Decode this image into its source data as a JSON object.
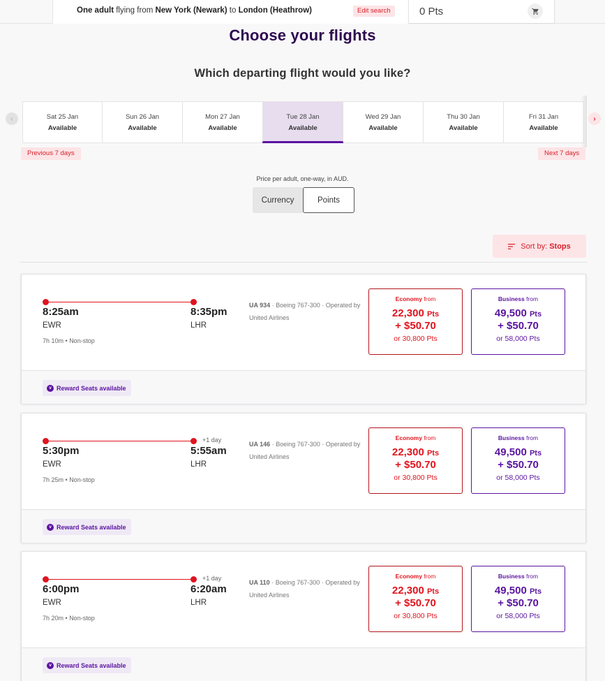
{
  "header": {
    "summary_prefix_bold": "One adult",
    "summary_mid1": " flying from ",
    "origin": "New York (Newark)",
    "summary_mid2": " to ",
    "destination": "London (Heathrow)",
    "edit_search_label": "Edit search",
    "points_balance": "0 Pts",
    "cart_icon": "shopping-cart-icon"
  },
  "page": {
    "title": "Choose your flights",
    "subtitle": "Which departing flight would you like?"
  },
  "date_strip": {
    "prev_arrow": "‹",
    "next_arrow": "›",
    "dates": [
      {
        "date": "Sat 25 Jan",
        "status": "Available",
        "selected": false
      },
      {
        "date": "Sun 26 Jan",
        "status": "Available",
        "selected": false
      },
      {
        "date": "Mon 27 Jan",
        "status": "Available",
        "selected": false
      },
      {
        "date": "Tue 28 Jan",
        "status": "Available",
        "selected": true
      },
      {
        "date": "Wed 29 Jan",
        "status": "Available",
        "selected": false
      },
      {
        "date": "Thu 30 Jan",
        "status": "Available",
        "selected": false
      },
      {
        "date": "Fri 31 Jan",
        "status": "Available",
        "selected": false
      }
    ],
    "previous_label": "Previous 7 days",
    "next_label": "Next 7 days"
  },
  "pricing": {
    "note": "Price per adult, one-way, in AUD.",
    "toggle_options": [
      "Currency",
      "Points"
    ],
    "selected_option": "Points"
  },
  "sort": {
    "prefix": "Sort by: ",
    "value": "Stops"
  },
  "flights": [
    {
      "depart_time": "8:25am",
      "depart_code": "EWR",
      "arrive_time": "8:35pm",
      "arrive_code": "LHR",
      "plus_day": "",
      "duration": "7h 10m",
      "stops": "Non-stop",
      "flight_no": "UA 934",
      "aircraft": "Boeing 767-300",
      "operated": "Operated by United Airlines",
      "economy": {
        "class": "Economy",
        "from": "from",
        "points": "22,300",
        "pts_unit": "Pts",
        "cash": "+ $50.70",
        "alt": "or 30,800 Pts"
      },
      "business": {
        "class": "Business",
        "from": "from",
        "points": "49,500",
        "pts_unit": "Pts",
        "cash": "+ $50.70",
        "alt": "or 58,000 Pts"
      },
      "reward_badge": "Reward Seats available"
    },
    {
      "depart_time": "5:30pm",
      "depart_code": "EWR",
      "arrive_time": "5:55am",
      "arrive_code": "LHR",
      "plus_day": "+1 day",
      "duration": "7h 25m",
      "stops": "Non-stop",
      "flight_no": "UA 146",
      "aircraft": "Boeing 767-300",
      "operated": "Operated by United Airlines",
      "economy": {
        "class": "Economy",
        "from": "from",
        "points": "22,300",
        "pts_unit": "Pts",
        "cash": "+ $50.70",
        "alt": "or 30,800 Pts"
      },
      "business": {
        "class": "Business",
        "from": "from",
        "points": "49,500",
        "pts_unit": "Pts",
        "cash": "+ $50.70",
        "alt": "or 58,000 Pts"
      },
      "reward_badge": "Reward Seats available"
    },
    {
      "depart_time": "6:00pm",
      "depart_code": "EWR",
      "arrive_time": "6:20am",
      "arrive_code": "LHR",
      "plus_day": "+1 day",
      "duration": "7h 20m",
      "stops": "Non-stop",
      "flight_no": "UA 110",
      "aircraft": "Boeing 767-300",
      "operated": "Operated by United Airlines",
      "economy": {
        "class": "Economy",
        "from": "from",
        "points": "22,300",
        "pts_unit": "Pts",
        "cash": "+ $50.70",
        "alt": "or 30,800 Pts"
      },
      "business": {
        "class": "Business",
        "from": "from",
        "points": "49,500",
        "pts_unit": "Pts",
        "cash": "+ $50.70",
        "alt": "or 58,000 Pts"
      },
      "reward_badge": "Reward Seats available"
    }
  ],
  "colors": {
    "brand_purple": "#5b14a0",
    "title_purple": "#2e0b4f",
    "accent_red": "#e0141e",
    "pink_bg": "#fde4e6"
  }
}
